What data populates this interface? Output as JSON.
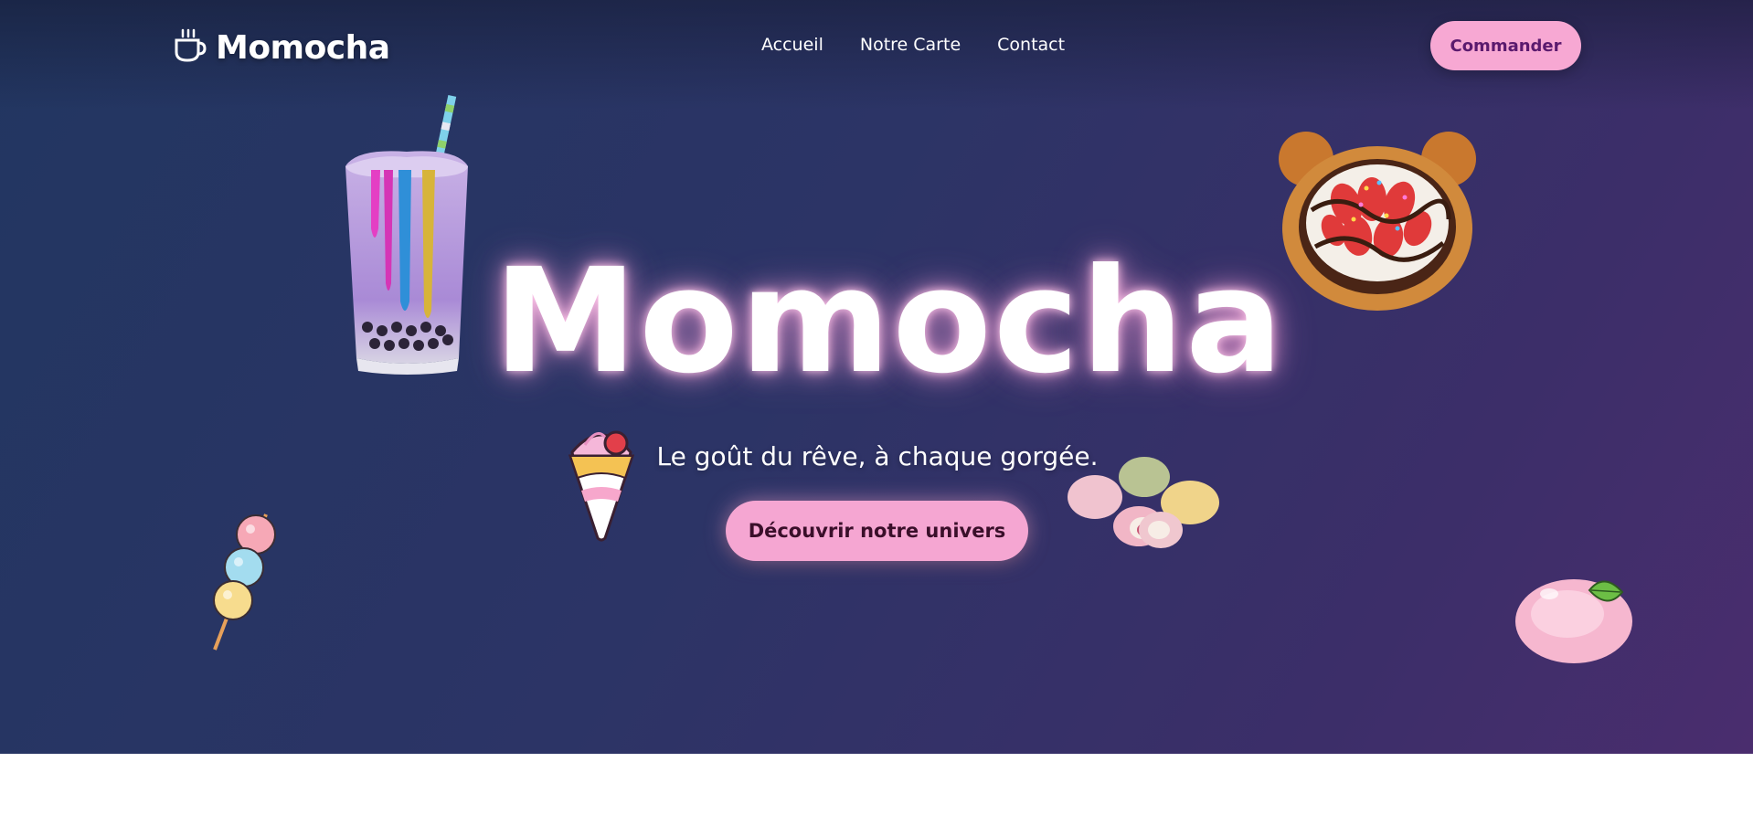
{
  "brand": {
    "name": "Momocha",
    "icon": "coffee-cup-icon"
  },
  "nav": {
    "items": [
      {
        "label": "Accueil"
      },
      {
        "label": "Notre Carte"
      },
      {
        "label": "Contact"
      }
    ],
    "cta_label": "Commander"
  },
  "hero": {
    "title": "Momocha",
    "tagline": "Le goût du rêve, à chaque gorgée.",
    "cta_label": "Découvrir notre univers"
  },
  "decorations": [
    "bubble-tea-icon",
    "bear-waffle-icon",
    "ice-cream-crepe-icon",
    "mochi-trio-icon",
    "dango-skewer-icon",
    "peach-mochi-icon"
  ],
  "colors": {
    "accent_pink": "#f7a8d3",
    "hero_gradient_start": "#223661",
    "hero_gradient_end": "#4a2d6e",
    "cta_text": "#5b1a6e"
  }
}
